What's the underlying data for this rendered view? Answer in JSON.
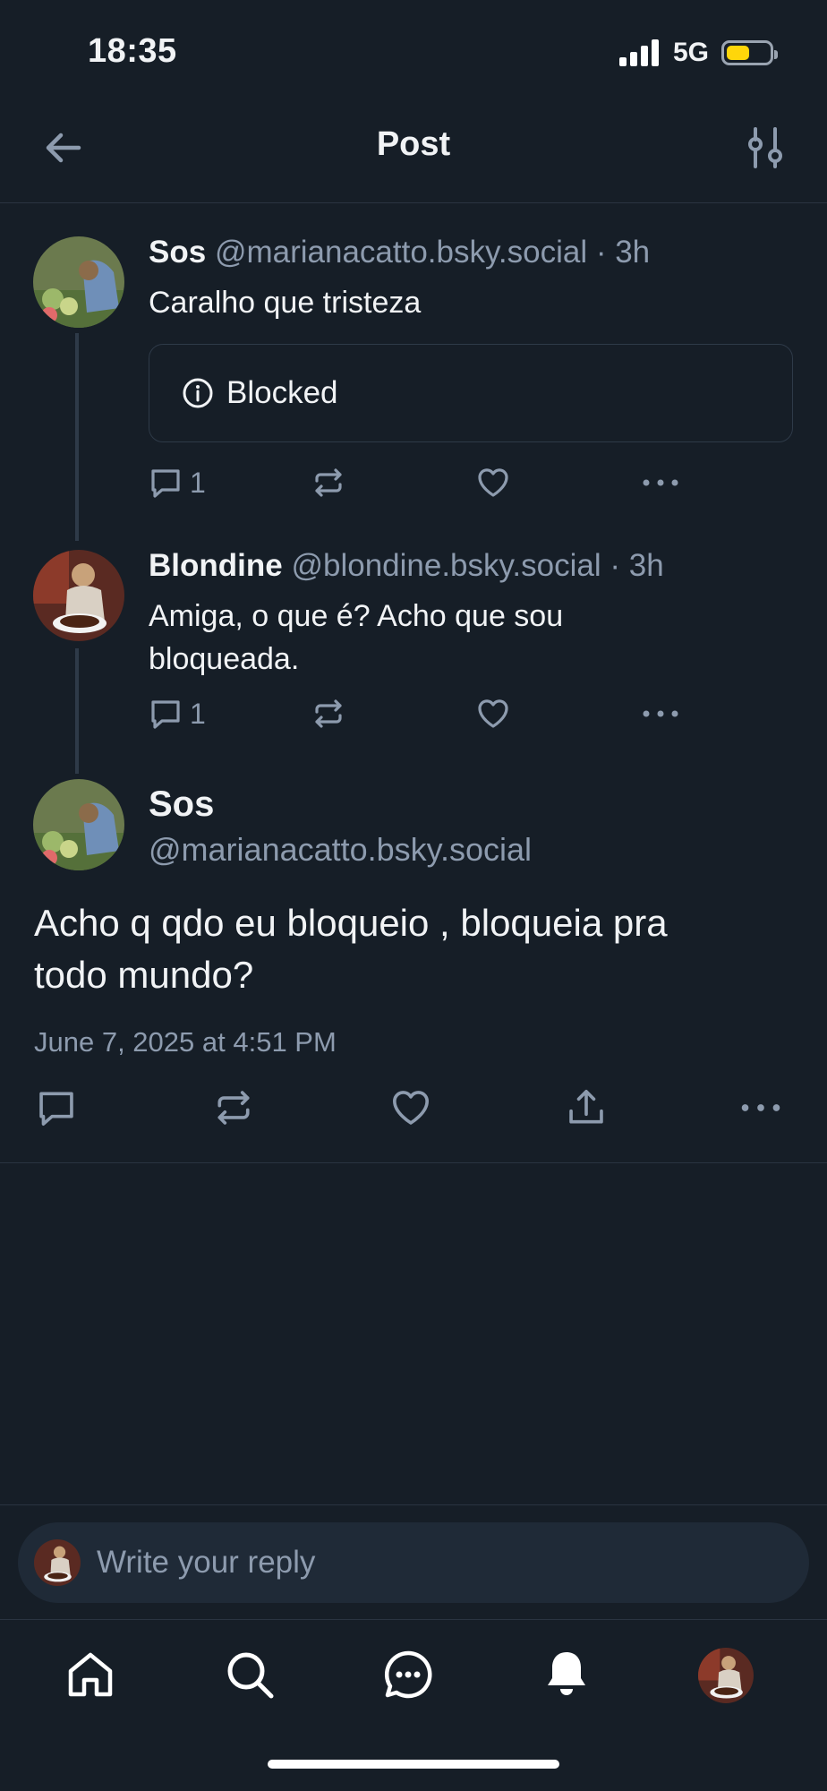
{
  "status_bar": {
    "time": "18:35",
    "network": "5G",
    "battery_level": 0.55
  },
  "header": {
    "title": "Post"
  },
  "thread": [
    {
      "name": "Sos",
      "handle": "@marianacatto.bsky.social",
      "time": "· 3h",
      "text": "Caralho que tristeza",
      "embed_label": "Blocked",
      "reply_count": "1"
    },
    {
      "name": "Blondine",
      "handle": "@blondine.bsky.social",
      "time": "· 3h",
      "text_line1": "Amiga, o que é? Acho que sou",
      "text_line2": "bloqueada.",
      "reply_count": "1"
    }
  ],
  "main_post": {
    "name": "Sos",
    "handle": "@marianacatto.bsky.social",
    "text_line1": "Acho q qdo eu bloqueio , bloqueia pra",
    "text_line2": "todo mundo?",
    "date": "June 7, 2025 at 4:51 PM"
  },
  "reply_box": {
    "placeholder": "Write your reply"
  },
  "tab_bar": {
    "items": [
      "home-icon",
      "search-icon",
      "chat-icon",
      "bell-icon",
      "profile-avatar"
    ]
  },
  "colors": {
    "background": "#161e27",
    "muted": "#8d9bae",
    "battery": "#ffd60a"
  }
}
